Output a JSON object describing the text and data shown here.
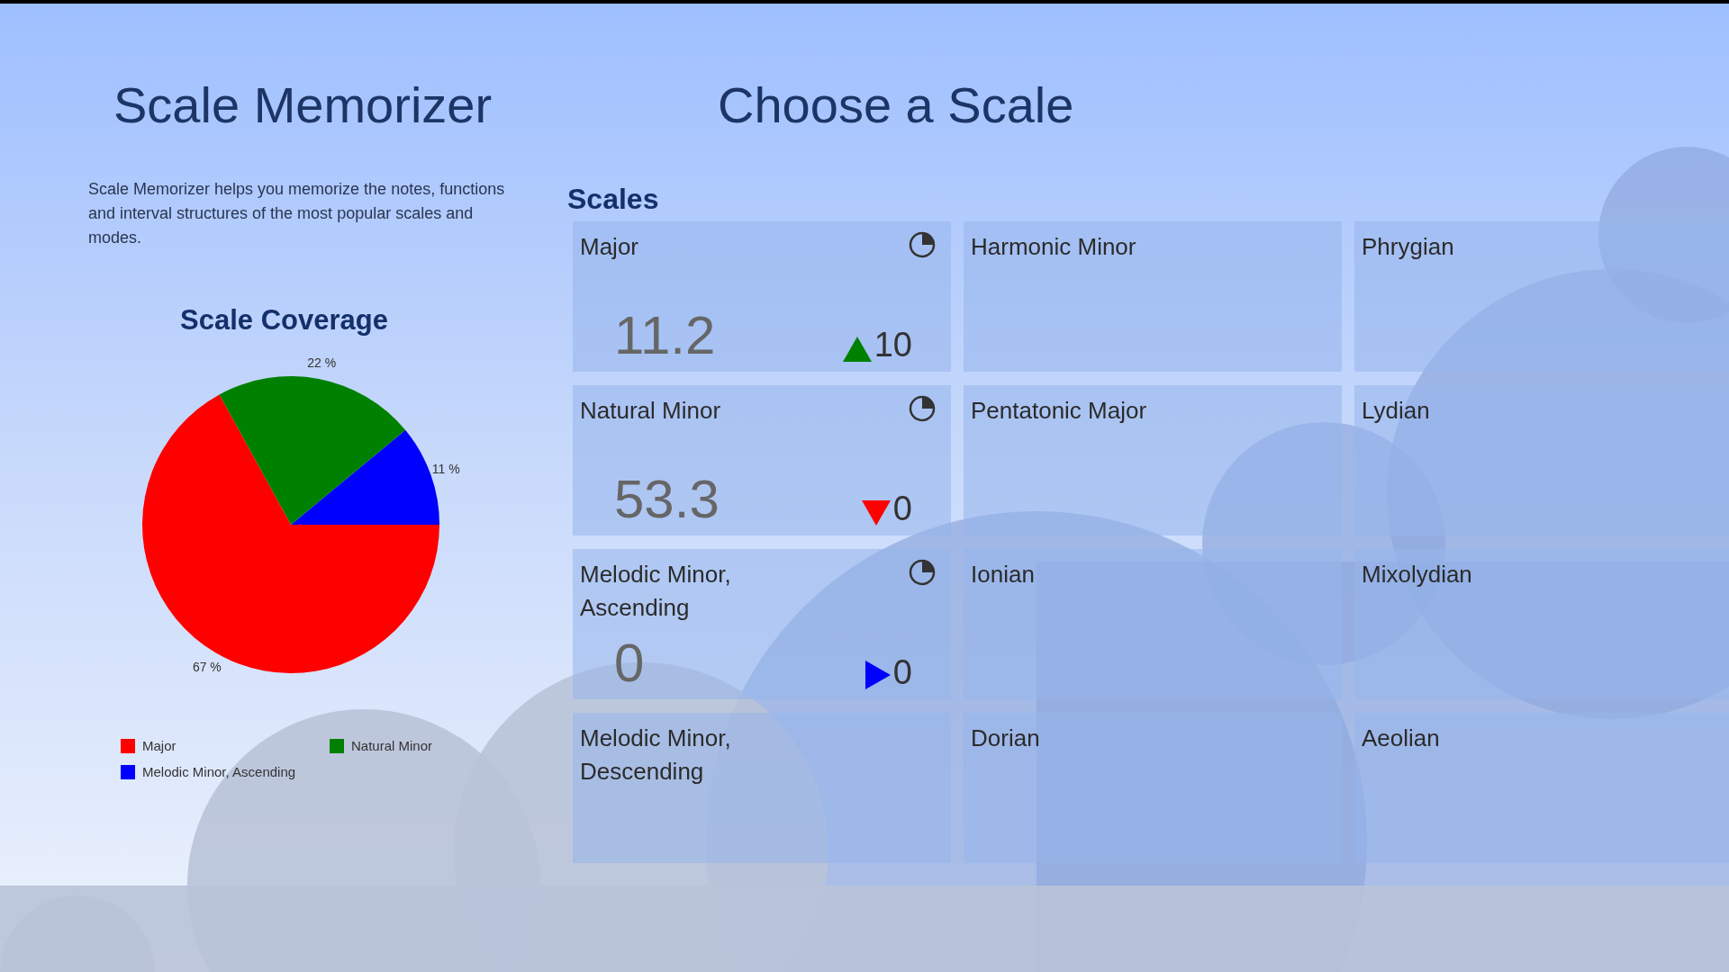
{
  "app_title": "Scale Memorizer",
  "description": "Scale Memorizer helps you memorize the notes, functions and interval structures of the most popular scales and modes.",
  "coverage": {
    "title": "Scale Coverage",
    "chart_data": {
      "type": "pie",
      "values": [
        67,
        22,
        11
      ],
      "value_labels": [
        "67 %",
        "22 %",
        "11 %"
      ]
    },
    "legend": [
      {
        "label": "Major",
        "color": "#ff0000"
      },
      {
        "label": "Natural Minor",
        "color": "#008000"
      },
      {
        "label": "Melodic Minor, Ascending",
        "color": "#0000ff"
      }
    ]
  },
  "page_title": "Choose a Scale",
  "section_title": "Scales",
  "tiles": [
    {
      "kind": "stats",
      "name": "Major",
      "score": "11.2",
      "delta": {
        "kind": "up",
        "text": "10"
      }
    },
    {
      "kind": "plain",
      "name": "Harmonic Minor"
    },
    {
      "kind": "plain",
      "name": "Phrygian"
    },
    {
      "kind": "stats",
      "name": "Natural Minor",
      "score": "53.3",
      "delta": {
        "kind": "down",
        "text": "0"
      }
    },
    {
      "kind": "plain",
      "name": "Pentatonic Major"
    },
    {
      "kind": "plain",
      "name": "Lydian"
    },
    {
      "kind": "stats",
      "name": "Melodic Minor, Ascending",
      "score": "0",
      "delta": {
        "kind": "flat",
        "text": "0"
      }
    },
    {
      "kind": "plain",
      "name": "Ionian"
    },
    {
      "kind": "plain",
      "name": "Mixolydian"
    },
    {
      "kind": "plain",
      "name": "Melodic Minor, Descending"
    },
    {
      "kind": "plain",
      "name": "Dorian"
    },
    {
      "kind": "plain",
      "name": "Aeolian"
    }
  ]
}
